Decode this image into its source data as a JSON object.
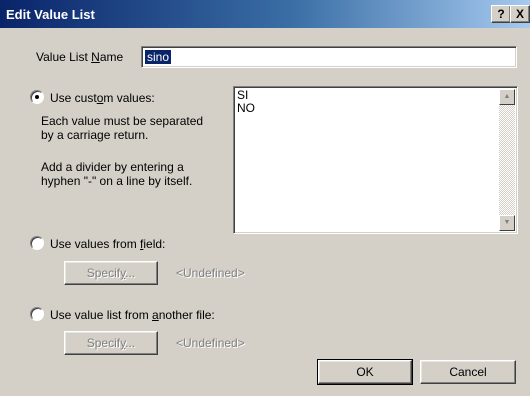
{
  "window": {
    "title": "Edit Value List",
    "help_label": "?",
    "close_label": "X"
  },
  "name_field": {
    "label_pre": "Value List ",
    "label_key": "N",
    "label_post": "ame",
    "value": "sino"
  },
  "custom": {
    "label_pre": "Use cust",
    "label_key": "o",
    "label_post": "m values:",
    "help_1": "Each value must be separated",
    "help_2": "by a carriage return.",
    "help_3": "Add a divider by entering a",
    "help_4": "hyphen \"-\" on a line by itself.",
    "values": "SI\nNO",
    "selected": true
  },
  "from_field": {
    "label_pre": "Use values from ",
    "label_key": "f",
    "label_post": "ield:",
    "specify_pre": "Specif",
    "specify_key": "y",
    "specify_post": "...",
    "undefined_label": "<Undefined>",
    "selected": false
  },
  "from_file": {
    "label_pre": "Use value list from ",
    "label_key": "a",
    "label_post": "nother file:",
    "specify_pre": "Specif",
    "specify_key": "y",
    "specify_post": "...",
    "undefined_label": "<Undefined>",
    "selected": false
  },
  "buttons": {
    "ok": "OK",
    "cancel": "Cancel"
  }
}
